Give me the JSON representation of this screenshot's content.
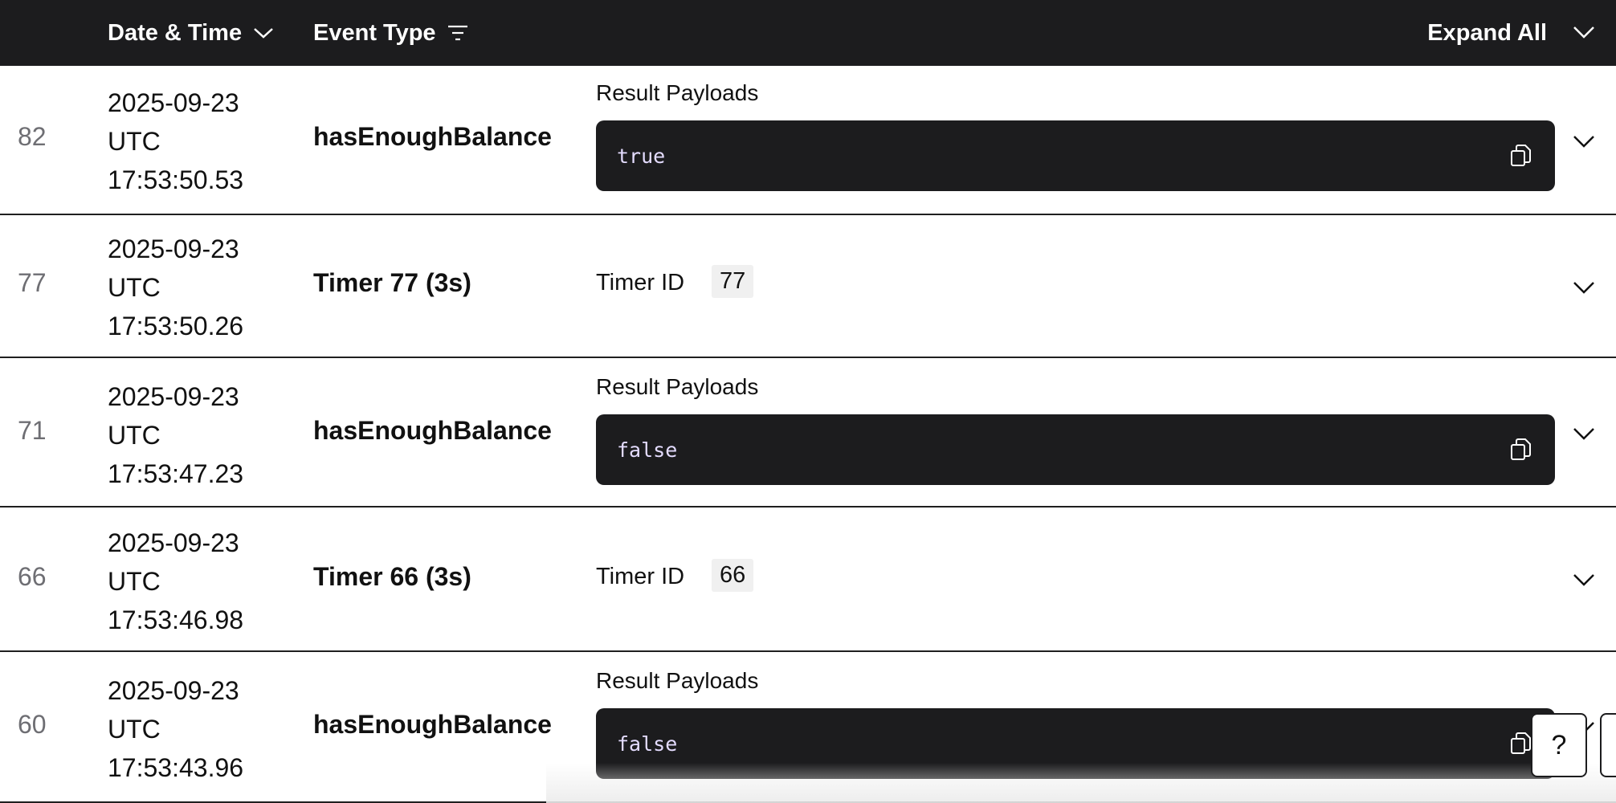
{
  "header": {
    "date_time_label": "Date & Time",
    "event_type_label": "Event Type",
    "expand_all_label": "Expand All",
    "icons": {
      "date_sort": "chevron-down-icon",
      "type_filter": "filter-icon",
      "expand_all": "chevron-down-icon"
    }
  },
  "rows": [
    {
      "index": "82",
      "date": "2025-09-23",
      "tz": "UTC",
      "time": "17:53:50.53",
      "event_type": "hasEnoughBalance",
      "detail_label": "Result Payloads",
      "payload": "true"
    },
    {
      "index": "77",
      "date": "2025-09-23",
      "tz": "UTC",
      "time": "17:53:50.26",
      "event_type": "Timer 77 (3s)",
      "detail_label": "Timer ID",
      "timer_id": "77"
    },
    {
      "index": "71",
      "date": "2025-09-23",
      "tz": "UTC",
      "time": "17:53:47.23",
      "event_type": "hasEnoughBalance",
      "detail_label": "Result Payloads",
      "payload": "false"
    },
    {
      "index": "66",
      "date": "2025-09-23",
      "tz": "UTC",
      "time": "17:53:46.98",
      "event_type": "Timer 66 (3s)",
      "detail_label": "Timer ID",
      "timer_id": "66"
    },
    {
      "index": "60",
      "date": "2025-09-23",
      "tz": "UTC",
      "time": "17:53:43.96",
      "event_type": "hasEnoughBalance",
      "detail_label": "Result Payloads",
      "payload": "false"
    }
  ],
  "help_button": {
    "label": "?"
  },
  "colors": {
    "header_bg": "#1c1c1e",
    "code_bg": "#1c1c1e",
    "code_text": "#e4dcff",
    "index_text": "#6e6e73",
    "divider": "#1f1f1f"
  }
}
